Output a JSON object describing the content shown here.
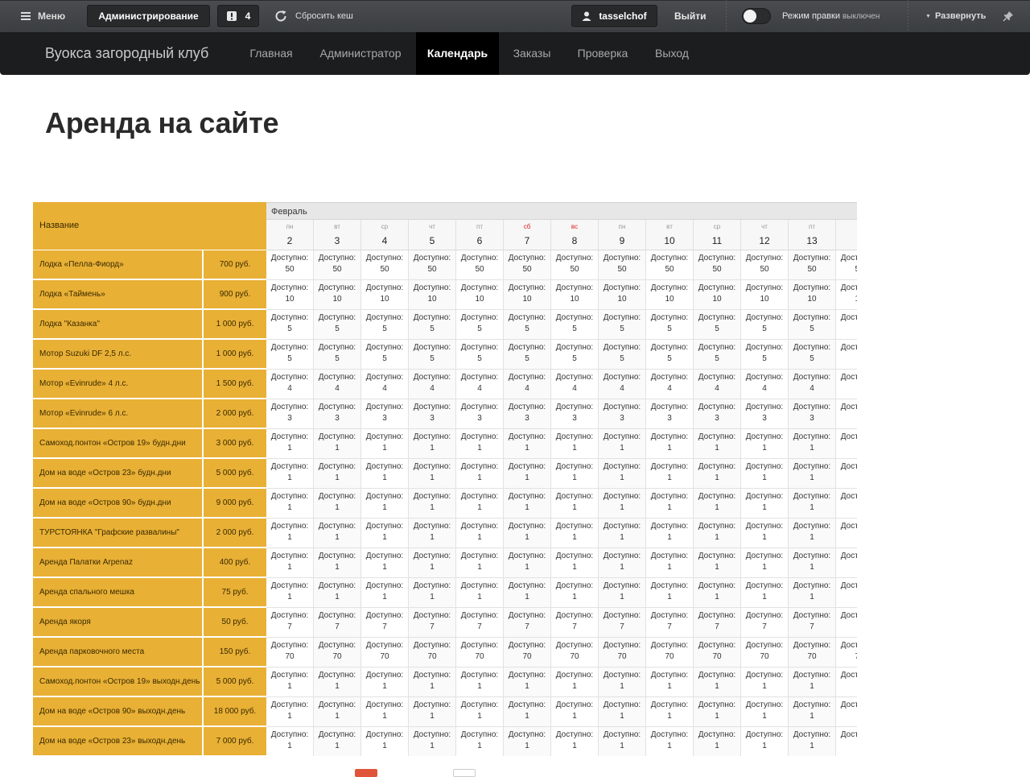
{
  "adminbar": {
    "menu_label": "Меню",
    "admin_label": "Администрирование",
    "notifications_count": "4",
    "clear_cache_label": "Сбросить кеш",
    "user_name": "tasselchof",
    "logout_label": "Выйти",
    "edit_mode_label": "Режим правки",
    "edit_mode_state": "выключен",
    "expand_label": "Развернуть"
  },
  "sitenav": {
    "brand": "Вуокса загородный клуб",
    "items": [
      {
        "label": "Главная",
        "active": false
      },
      {
        "label": "Администратор",
        "active": false
      },
      {
        "label": "Календарь",
        "active": true
      },
      {
        "label": "Заказы",
        "active": false
      },
      {
        "label": "Проверка",
        "active": false
      },
      {
        "label": "Выход",
        "active": false
      }
    ]
  },
  "page": {
    "title": "Аренда на сайте"
  },
  "calendar": {
    "name_header": "Название",
    "month": "Февраль",
    "cell_label": "Доступно:",
    "days": [
      {
        "dow": "пн",
        "num": "2",
        "weekend": false
      },
      {
        "dow": "вт",
        "num": "3",
        "weekend": false
      },
      {
        "dow": "ср",
        "num": "4",
        "weekend": false
      },
      {
        "dow": "чт",
        "num": "5",
        "weekend": false
      },
      {
        "dow": "пт",
        "num": "6",
        "weekend": false
      },
      {
        "dow": "сб",
        "num": "7",
        "weekend": true
      },
      {
        "dow": "вс",
        "num": "8",
        "weekend": true
      },
      {
        "dow": "пн",
        "num": "9",
        "weekend": false
      },
      {
        "dow": "вт",
        "num": "10",
        "weekend": false
      },
      {
        "dow": "ср",
        "num": "11",
        "weekend": false
      },
      {
        "dow": "чт",
        "num": "12",
        "weekend": false
      },
      {
        "dow": "пт",
        "num": "13",
        "weekend": false
      },
      {
        "dow": "",
        "num": "",
        "weekend": false
      }
    ],
    "rows": [
      {
        "name": "Лодка «Пелла-Фиорд»",
        "price": "700 руб.",
        "available": "50"
      },
      {
        "name": "Лодка «Таймень»",
        "price": "900 руб.",
        "available": "10"
      },
      {
        "name": "Лодка \"Казанка\"",
        "price": "1 000 руб.",
        "available": "5"
      },
      {
        "name": "Мотор Suzuki DF 2,5 л.с.",
        "price": "1 000 руб.",
        "available": "5"
      },
      {
        "name": "Мотор «Evinrude» 4 л.с.",
        "price": "1 500 руб.",
        "available": "4"
      },
      {
        "name": "Мотор «Evinrude» 6 л.с.",
        "price": "2 000 руб.",
        "available": "3"
      },
      {
        "name": "Самоход.понтон «Остров 19» будн.дни",
        "price": "3 000 руб.",
        "available": "1"
      },
      {
        "name": "Дом на воде «Остров 23» будн.дни",
        "price": "5 000 руб.",
        "available": "1"
      },
      {
        "name": "Дом на воде «Остров 90» будн.дни",
        "price": "9 000 руб.",
        "available": "1"
      },
      {
        "name": "ТУРСТОЯНКА \"Графские развалины\"",
        "price": "2 000 руб.",
        "available": "1"
      },
      {
        "name": "Аренда Палатки Arpenaz",
        "price": "400 руб.",
        "available": "1"
      },
      {
        "name": "Аренда спального мешка",
        "price": "75 руб.",
        "available": "1"
      },
      {
        "name": "Аренда якоря",
        "price": "50 руб.",
        "available": "7"
      },
      {
        "name": "Аренда парковочного места",
        "price": "150 руб.",
        "available": "70"
      },
      {
        "name": "Самоход.понтон «Остров 19» выходн.день",
        "price": "5 000 руб.",
        "available": "1"
      },
      {
        "name": "Дом на воде «Остров 90» выходн.день",
        "price": "18 000 руб.",
        "available": "1"
      },
      {
        "name": "Дом на воде «Остров 23» выходн.день",
        "price": "7 000 руб.",
        "available": "1"
      }
    ]
  },
  "colors": {
    "accent_row": "#e8b035",
    "nav_bg": "#1c1d1f",
    "weekend": "#e02020"
  }
}
